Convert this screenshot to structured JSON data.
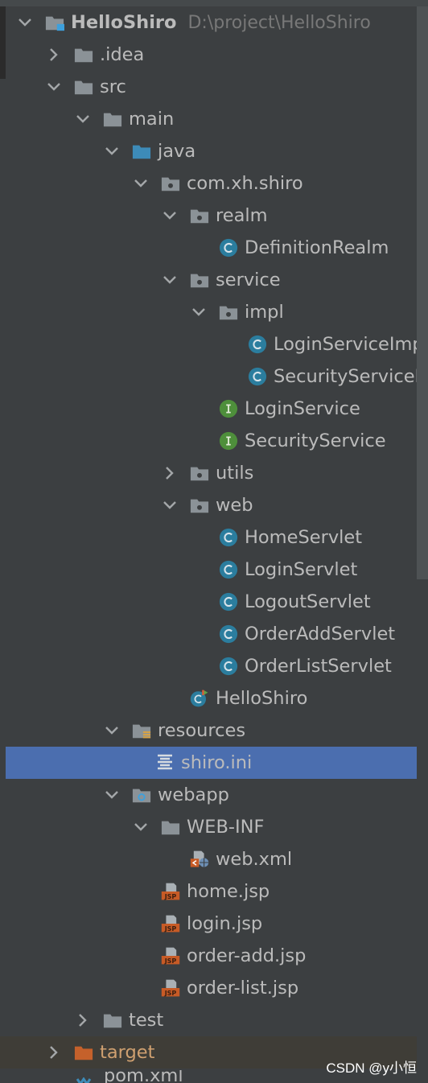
{
  "project": {
    "name": "HelloShiro",
    "path": "D:\\project\\HelloShiro"
  },
  "tree": [
    {
      "id": "root",
      "label": "HelloShiro",
      "depth": 0,
      "arrow": "down",
      "icon": "project-folder-icon"
    },
    {
      "id": "idea",
      "label": ".idea",
      "depth": 1,
      "arrow": "right",
      "icon": "folder-icon"
    },
    {
      "id": "src",
      "label": "src",
      "depth": 1,
      "arrow": "down",
      "icon": "folder-icon"
    },
    {
      "id": "main",
      "label": "main",
      "depth": 2,
      "arrow": "down",
      "icon": "folder-icon"
    },
    {
      "id": "java",
      "label": "java",
      "depth": 3,
      "arrow": "down",
      "icon": "source-folder-icon"
    },
    {
      "id": "pkg",
      "label": "com.xh.shiro",
      "depth": 4,
      "arrow": "down",
      "icon": "package-icon"
    },
    {
      "id": "realm",
      "label": "realm",
      "depth": 5,
      "arrow": "down",
      "icon": "package-icon"
    },
    {
      "id": "defrealm",
      "label": "DefinitionRealm",
      "depth": 6,
      "arrow": "none",
      "icon": "class-icon"
    },
    {
      "id": "service",
      "label": "service",
      "depth": 5,
      "arrow": "down",
      "icon": "package-icon"
    },
    {
      "id": "impl",
      "label": "impl",
      "depth": 6,
      "arrow": "down",
      "icon": "package-icon"
    },
    {
      "id": "loginimpl",
      "label": "LoginServiceImp",
      "depth": 7,
      "arrow": "none",
      "icon": "class-icon"
    },
    {
      "id": "secimpl",
      "label": "SecurityServiceIm",
      "depth": 7,
      "arrow": "none",
      "icon": "class-icon"
    },
    {
      "id": "loginsvc",
      "label": "LoginService",
      "depth": 6,
      "arrow": "none",
      "icon": "interface-icon"
    },
    {
      "id": "secsvc",
      "label": "SecurityService",
      "depth": 6,
      "arrow": "none",
      "icon": "interface-icon"
    },
    {
      "id": "utils",
      "label": "utils",
      "depth": 5,
      "arrow": "right",
      "icon": "package-icon"
    },
    {
      "id": "web",
      "label": "web",
      "depth": 5,
      "arrow": "down",
      "icon": "package-icon"
    },
    {
      "id": "home",
      "label": "HomeServlet",
      "depth": 6,
      "arrow": "none",
      "icon": "class-icon"
    },
    {
      "id": "login",
      "label": "LoginServlet",
      "depth": 6,
      "arrow": "none",
      "icon": "class-icon"
    },
    {
      "id": "logout",
      "label": "LogoutServlet",
      "depth": 6,
      "arrow": "none",
      "icon": "class-icon"
    },
    {
      "id": "orderadd",
      "label": "OrderAddServlet",
      "depth": 6,
      "arrow": "none",
      "icon": "class-icon"
    },
    {
      "id": "orderlist",
      "label": "OrderListServlet",
      "depth": 6,
      "arrow": "none",
      "icon": "class-icon"
    },
    {
      "id": "helloshiro",
      "label": "HelloShiro",
      "depth": 5,
      "arrow": "none",
      "icon": "main-class-icon"
    },
    {
      "id": "resources",
      "label": "resources",
      "depth": 3,
      "arrow": "down",
      "icon": "resources-folder-icon"
    },
    {
      "id": "shiroini",
      "label": "shiro.ini",
      "depth": 4,
      "arrow": "none",
      "icon": "ini-file-icon",
      "selected": true
    },
    {
      "id": "webapp",
      "label": "webapp",
      "depth": 3,
      "arrow": "down",
      "icon": "web-folder-icon"
    },
    {
      "id": "webinf",
      "label": "WEB-INF",
      "depth": 4,
      "arrow": "down",
      "icon": "folder-icon"
    },
    {
      "id": "webxml",
      "label": "web.xml",
      "depth": 5,
      "arrow": "none",
      "icon": "webxml-icon"
    },
    {
      "id": "homejsp",
      "label": "home.jsp",
      "depth": 4,
      "arrow": "none",
      "icon": "jsp-icon"
    },
    {
      "id": "loginjsp",
      "label": "login.jsp",
      "depth": 4,
      "arrow": "none",
      "icon": "jsp-icon"
    },
    {
      "id": "orderaddjsp",
      "label": "order-add.jsp",
      "depth": 4,
      "arrow": "none",
      "icon": "jsp-icon"
    },
    {
      "id": "orderlistjsp",
      "label": "order-list.jsp",
      "depth": 4,
      "arrow": "none",
      "icon": "jsp-icon"
    },
    {
      "id": "test",
      "label": "test",
      "depth": 2,
      "arrow": "right",
      "icon": "folder-icon"
    },
    {
      "id": "target",
      "label": "target",
      "depth": 1,
      "arrow": "right",
      "icon": "excluded-folder-icon",
      "excluded": true
    }
  ],
  "cutoff_item": {
    "label": "pom.xml",
    "icon": "maven-icon"
  },
  "watermark": "CSDN @y小恒",
  "colors": {
    "background": "#3c3f41",
    "selection": "#4b6eaf",
    "folder": "#8b9297",
    "source_folder": "#3d8bb8",
    "class_icon": "#2b7d9e",
    "interface_icon": "#4e8f3b",
    "jsp_orange": "#c75b26",
    "excluded_folder": "#c5612b"
  }
}
